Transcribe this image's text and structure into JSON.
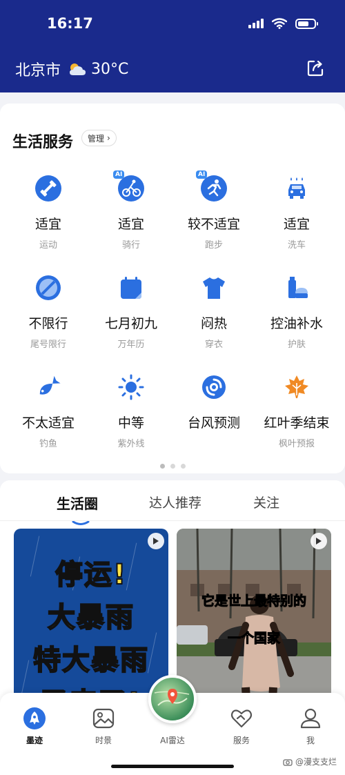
{
  "status_bar": {
    "time": "16:17"
  },
  "header": {
    "city": "北京市",
    "temperature": "30°C",
    "weather_icon": "partly-cloudy-icon",
    "share_icon": "share-icon"
  },
  "life_services": {
    "title": "生活服务",
    "manage_label": "管理",
    "items": [
      {
        "main": "适宜",
        "sub": "运动",
        "icon": "dumbbell-icon"
      },
      {
        "main": "适宜",
        "sub": "骑行",
        "icon": "cycling-icon",
        "badge": "AI"
      },
      {
        "main": "较不适宜",
        "sub": "跑步",
        "icon": "running-icon",
        "badge": "AI"
      },
      {
        "main": "适宜",
        "sub": "洗车",
        "icon": "car-wash-icon"
      },
      {
        "main": "不限行",
        "sub": "尾号限行",
        "icon": "no-restriction-icon"
      },
      {
        "main": "七月初九",
        "sub": "万年历",
        "icon": "calendar-icon"
      },
      {
        "main": "闷热",
        "sub": "穿衣",
        "icon": "tshirt-icon"
      },
      {
        "main": "控油补水",
        "sub": "护肤",
        "icon": "skincare-icon"
      },
      {
        "main": "不太适宜",
        "sub": "钓鱼",
        "icon": "fish-icon"
      },
      {
        "main": "中等",
        "sub": "紫外线",
        "icon": "sun-icon"
      },
      {
        "main": "台风预测",
        "sub": "",
        "icon": "typhoon-icon"
      },
      {
        "main": "红叶季结束",
        "sub": "枫叶预报",
        "icon": "maple-leaf-icon"
      }
    ]
  },
  "feed": {
    "tabs": [
      {
        "label": "生活圈",
        "active": true
      },
      {
        "label": "达人推荐",
        "active": false
      },
      {
        "label": "关注",
        "active": false
      }
    ],
    "posts": [
      {
        "headline_lines": [
          "停运!",
          "大暴雨",
          "特大暴雨",
          "又来了!"
        ]
      },
      {
        "caption_lines": [
          "它是世上最特别的",
          "一个国家"
        ]
      }
    ]
  },
  "bottom_nav": {
    "items": [
      {
        "label": "墨迹",
        "active": true
      },
      {
        "label": "时景",
        "active": false
      },
      {
        "label": "AI雷达",
        "active": false
      },
      {
        "label": "服务",
        "active": false
      },
      {
        "label": "我",
        "active": false
      }
    ]
  },
  "watermark": "@漫支支烂",
  "colors": {
    "header_bg": "#1a2a8c",
    "accent_blue": "#2b6fe0",
    "accent_orange": "#f08a24",
    "headline_yellow": "#fde146"
  }
}
